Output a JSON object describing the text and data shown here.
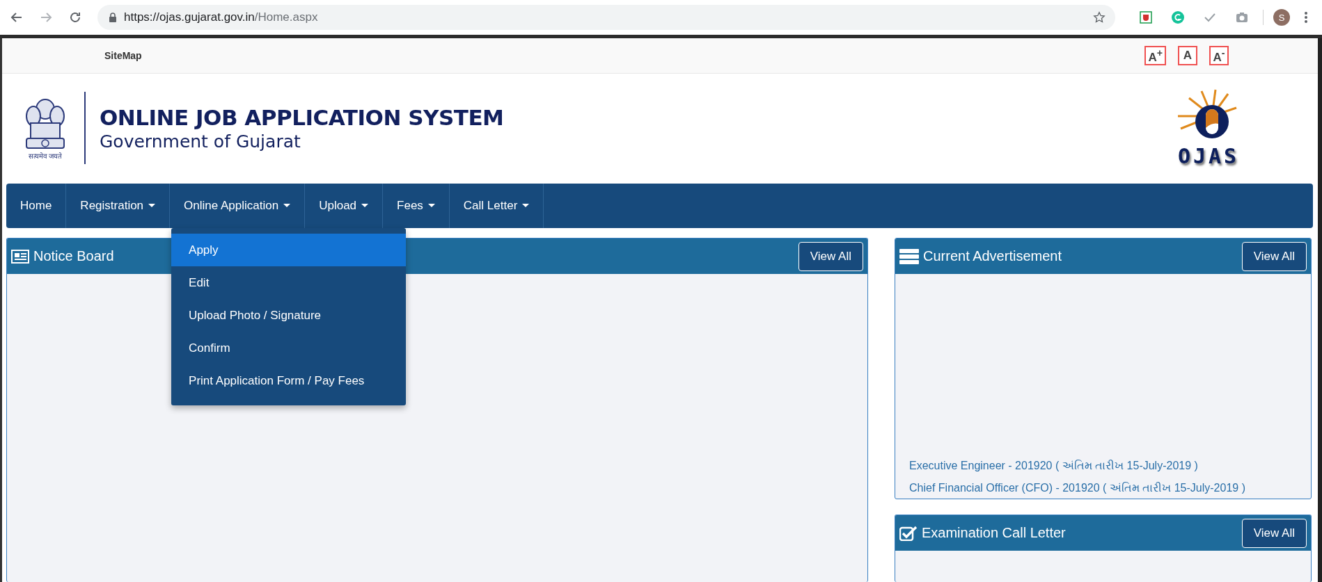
{
  "browser": {
    "url_host": "https://ojas.gujarat.gov.in",
    "url_path": "/Home.aspx",
    "profile_initial": "S"
  },
  "top_bar": {
    "links": [
      "SiteMap"
    ],
    "font_size_buttons": [
      {
        "label": "A$^{+}$"
      },
      {
        "label": "A"
      },
      {
        "label": "A$^{-}$"
      }
    ]
  },
  "header": {
    "emblem_caption": "सत्यमेव जयते",
    "title": "ONLINE JOB APPLICATION SYSTEM",
    "subtitle": "Government of Gujarat",
    "logo_text": "OJAS"
  },
  "nav": {
    "items": [
      {
        "label": "Home",
        "has_caret": false,
        "open": false
      },
      {
        "label": "Registration",
        "has_caret": true,
        "open": false
      },
      {
        "label": "Online Application",
        "has_caret": true,
        "open": true
      },
      {
        "label": "Upload",
        "has_caret": true,
        "open": false
      },
      {
        "label": "Fees",
        "has_caret": true,
        "open": false
      },
      {
        "label": "Call Letter",
        "has_caret": true,
        "open": false
      }
    ],
    "dropdown": [
      {
        "label": "Apply",
        "selected": true
      },
      {
        "label": "Edit",
        "selected": false
      },
      {
        "label": "Upload Photo / Signature",
        "selected": false
      },
      {
        "label": "Confirm",
        "selected": false
      },
      {
        "label": "Print Application Form / Pay Fees",
        "selected": false
      }
    ]
  },
  "panels": {
    "left": [
      {
        "kind": "newspaper",
        "title": "Notice Board",
        "button": "View All"
      }
    ],
    "right": [
      {
        "kind": "list",
        "title": "Current Advertisement",
        "button": "View All",
        "items": [
          "Executive Engineer - 201920 ( અંતિમ તારીખ 15-July-2019 )",
          "Chief Financial Officer (CFO) - 201920 ( અંતિમ તારીખ 15-July-2019 )"
        ]
      },
      {
        "kind": "checkbox",
        "title": "Examination Call Letter",
        "button": "View All"
      }
    ]
  }
}
